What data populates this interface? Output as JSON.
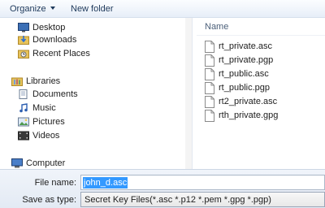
{
  "toolbar": {
    "organize_label": "Organize",
    "new_folder_label": "New folder"
  },
  "nav": {
    "items": [
      {
        "label": "Desktop",
        "icon": "desktop-icon"
      },
      {
        "label": "Downloads",
        "icon": "downloads-icon"
      },
      {
        "label": "Recent Places",
        "icon": "recent-places-icon"
      },
      {
        "label": "Libraries",
        "icon": "libraries-icon"
      },
      {
        "label": "Documents",
        "icon": "documents-icon"
      },
      {
        "label": "Music",
        "icon": "music-icon"
      },
      {
        "label": "Pictures",
        "icon": "pictures-icon"
      },
      {
        "label": "Videos",
        "icon": "videos-icon"
      },
      {
        "label": "Computer",
        "icon": "computer-icon"
      }
    ]
  },
  "files": {
    "column_name": "Name",
    "items": [
      "rt_private.asc",
      "rt_private.pgp",
      "rt_public.asc",
      "rt_public.pgp",
      "rt2_private.asc",
      "rth_private.gpg"
    ]
  },
  "form": {
    "file_name_label": "File name:",
    "file_name_value": "john_d.asc",
    "save_as_type_label": "Save as type:",
    "save_as_type_value": "Secret Key Files(*.asc *.p12 *.pem *.gpg *.pgp)"
  },
  "colors": {
    "selection": "#3399ff",
    "toolbar_text": "#1e395b",
    "folder": "#e8c35a"
  }
}
